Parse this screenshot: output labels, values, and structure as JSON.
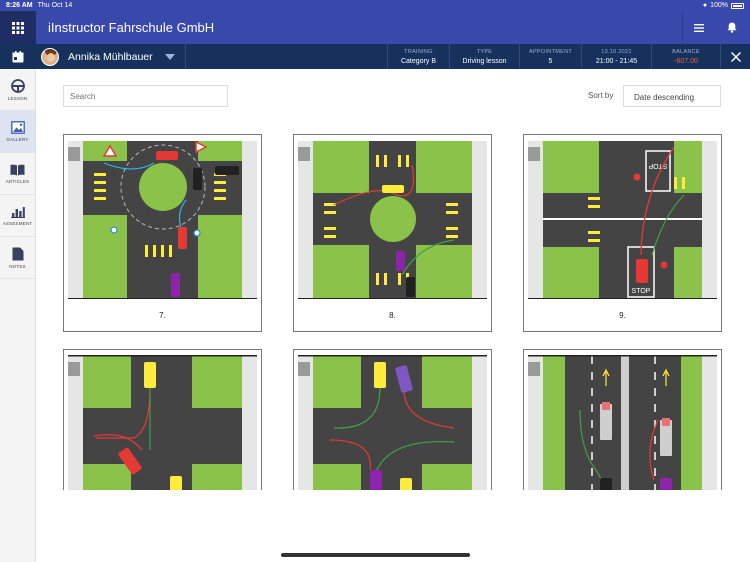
{
  "status_bar": {
    "time": "8:26 AM",
    "date": "Thu Oct 14",
    "battery": "100%"
  },
  "header": {
    "title": "iInstructor Fahrschule GmbH",
    "icons": [
      "grid-icon",
      "menu-icon",
      "bell-icon"
    ]
  },
  "subheader": {
    "student_name": "Annika Mühlbauer",
    "training_label": "TRAINING",
    "training_value": "Category B",
    "type_label": "TYPE",
    "type_value": "Driving lesson",
    "appointment_label": "APPOINTMENT",
    "appointment_value": "5",
    "date_label": "13.10.2021",
    "date_value": "21:00 - 21:45",
    "balance_label": "BALANCE",
    "balance_value": "-607.00",
    "balance_color": "#e8632b"
  },
  "sidebar": {
    "items": [
      {
        "label": "LESSON",
        "icon": "steering-wheel-icon"
      },
      {
        "label": "GALLERY",
        "icon": "image-icon"
      },
      {
        "label": "ARTICLES",
        "icon": "book-icon"
      },
      {
        "label": "ASSESMENT",
        "icon": "bar-chart-icon"
      },
      {
        "label": "NOTES",
        "icon": "note-icon"
      }
    ]
  },
  "search": {
    "placeholder": "Search"
  },
  "sort": {
    "label": "Sort by",
    "value": "Date descending"
  },
  "gallery": {
    "cards": [
      {
        "caption": "7."
      },
      {
        "caption": "8."
      },
      {
        "caption": "9."
      },
      {
        "caption": ""
      },
      {
        "caption": ""
      },
      {
        "caption": ""
      }
    ]
  },
  "colors": {
    "header": "#3949ab",
    "subheader": "#16325c",
    "grass": "#8bc34a",
    "road": "#444444"
  }
}
